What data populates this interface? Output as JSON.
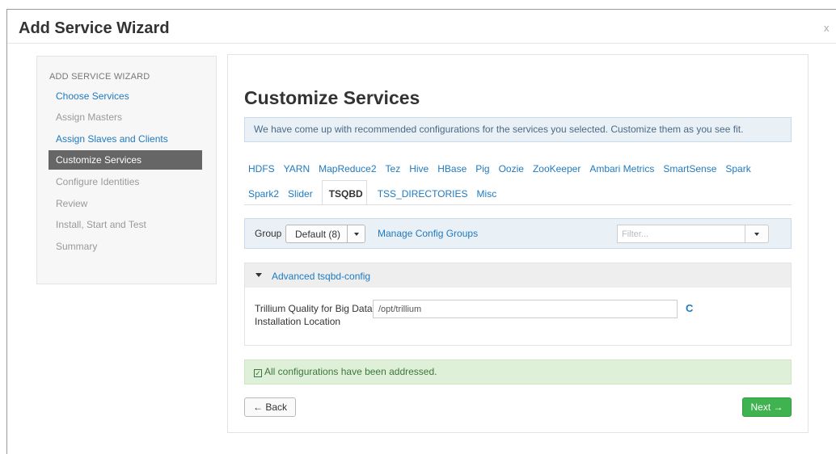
{
  "modal": {
    "title": "Add Service Wizard",
    "close_label": "x"
  },
  "sidebar": {
    "heading": "ADD SERVICE WIZARD",
    "items": [
      {
        "label": "Choose Services",
        "state": "link"
      },
      {
        "label": "Assign Masters",
        "state": "disabled"
      },
      {
        "label": "Assign Slaves and Clients",
        "state": "link"
      },
      {
        "label": "Customize Services",
        "state": "active"
      },
      {
        "label": "Configure Identities",
        "state": "disabled"
      },
      {
        "label": "Review",
        "state": "disabled"
      },
      {
        "label": "Install, Start and Test",
        "state": "disabled"
      },
      {
        "label": "Summary",
        "state": "disabled"
      }
    ]
  },
  "main": {
    "title": "Customize Services",
    "info": "We have come up with recommended configurations for the services you selected. Customize them as you see fit.",
    "tabs_row1": [
      "HDFS",
      "YARN",
      "MapReduce2",
      "Tez",
      "Hive",
      "HBase",
      "Pig",
      "Oozie",
      "ZooKeeper",
      "Ambari Metrics",
      "SmartSense",
      "Spark"
    ],
    "tabs_row2": [
      "Spark2",
      "Slider",
      "TSQBD",
      "TSS_DIRECTORIES",
      "Misc"
    ],
    "active_tab": "TSQBD",
    "group": {
      "label": "Group",
      "selected": "Default (8)",
      "manage_link": "Manage Config Groups",
      "filter_placeholder": "Filter..."
    },
    "section": {
      "title": "Advanced tsqbd-config",
      "field_label": "Trillium Quality for Big Data Installation Location",
      "field_value": "/opt/trillium",
      "refresh_glyph": "C"
    },
    "success": "All configurations have been addressed.",
    "back_label": "← Back",
    "next_label": "Next →"
  },
  "colors": {
    "link": "#1f7abf",
    "active_step_bg": "#666666",
    "info_bg": "#e9f0f6",
    "success_bg": "#dff0d8",
    "next_button": "#3fb34f"
  }
}
